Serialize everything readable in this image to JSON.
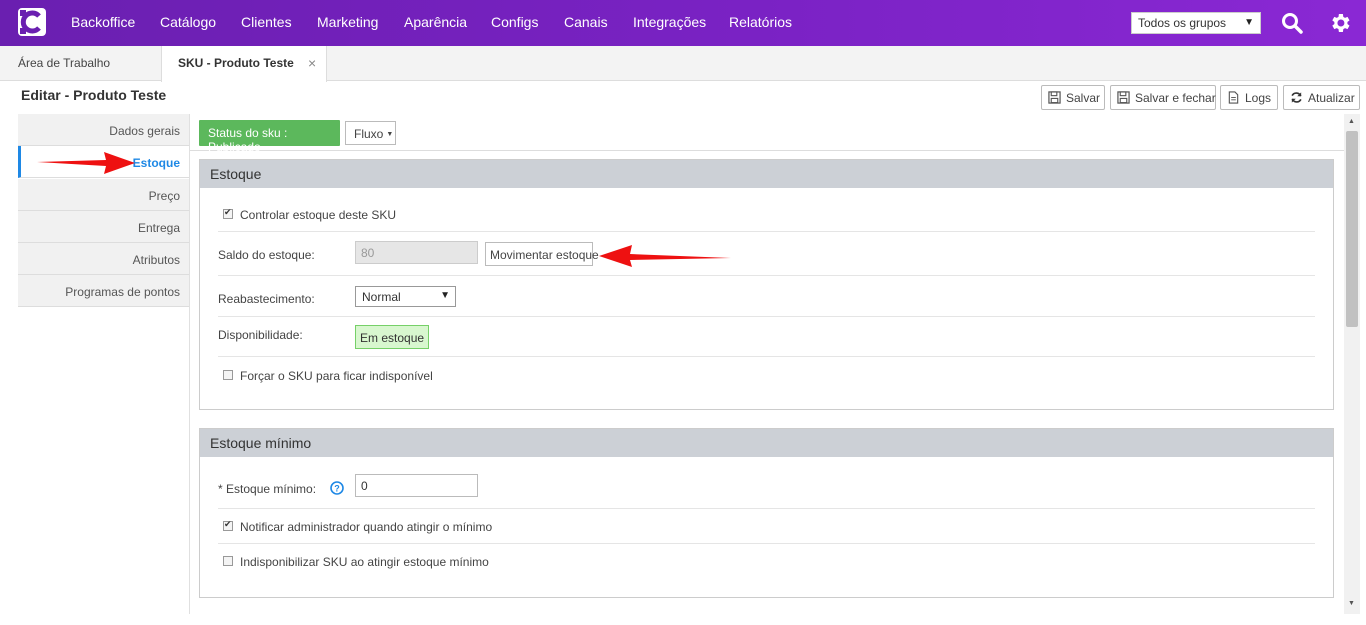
{
  "topnav": {
    "logo_icon": "c-logo-icon",
    "items": [
      "Backoffice",
      "Catálogo",
      "Clientes",
      "Marketing",
      "Aparência",
      "Configs",
      "Canais",
      "Integrações",
      "Relatórios"
    ],
    "group_select": "Todos os grupos",
    "search_icon": "search-icon",
    "settings_icon": "gear-icon"
  },
  "tabs": [
    {
      "label": "Área de Trabalho"
    },
    {
      "label": "SKU - Produto Teste"
    }
  ],
  "tab_close": "×",
  "page": {
    "title": "Editar - Produto Teste"
  },
  "toolbar": {
    "save": "Salvar",
    "save_close": "Salvar e fechar",
    "logs": "Logs",
    "refresh": "Atualizar"
  },
  "sidebar": {
    "items": [
      "Dados gerais",
      "Estoque",
      "Preço",
      "Entrega",
      "Atributos",
      "Programas de pontos"
    ],
    "active_index": 1
  },
  "status": {
    "badge": "Status do sku : Publicado",
    "fluxo": "Fluxo"
  },
  "estoque": {
    "title": "Estoque",
    "controlar_label": "Controlar estoque deste SKU",
    "controlar_checked": true,
    "saldo_label": "Saldo do estoque:",
    "saldo_value": "80",
    "movimentar_button": "Movimentar estoque",
    "reabastecimento_label": "Reabastecimento:",
    "reabastecimento_value": "Normal",
    "disponibilidade_label": "Disponibilidade:",
    "disponibilidade_value": "Em estoque",
    "forcar_label": "Forçar o SKU para ficar indisponível",
    "forcar_checked": false
  },
  "estoque_minimo": {
    "title": "Estoque mínimo",
    "minimo_label": "* Estoque mínimo:",
    "help_icon": "help-icon",
    "minimo_value": "0",
    "notificar_label": "Notificar administrador quando atingir o mínimo",
    "notificar_checked": true,
    "indisponibilizar_label": "Indisponibilizar SKU ao atingir estoque mínimo",
    "indisponibilizar_checked": false
  },
  "colors": {
    "nav_gradient_start": "#6a1fb0",
    "nav_gradient_end": "#8a28d4",
    "accent_blue": "#1e88e5",
    "status_green": "#5cb85c",
    "annotation_red": "#ee1111"
  }
}
